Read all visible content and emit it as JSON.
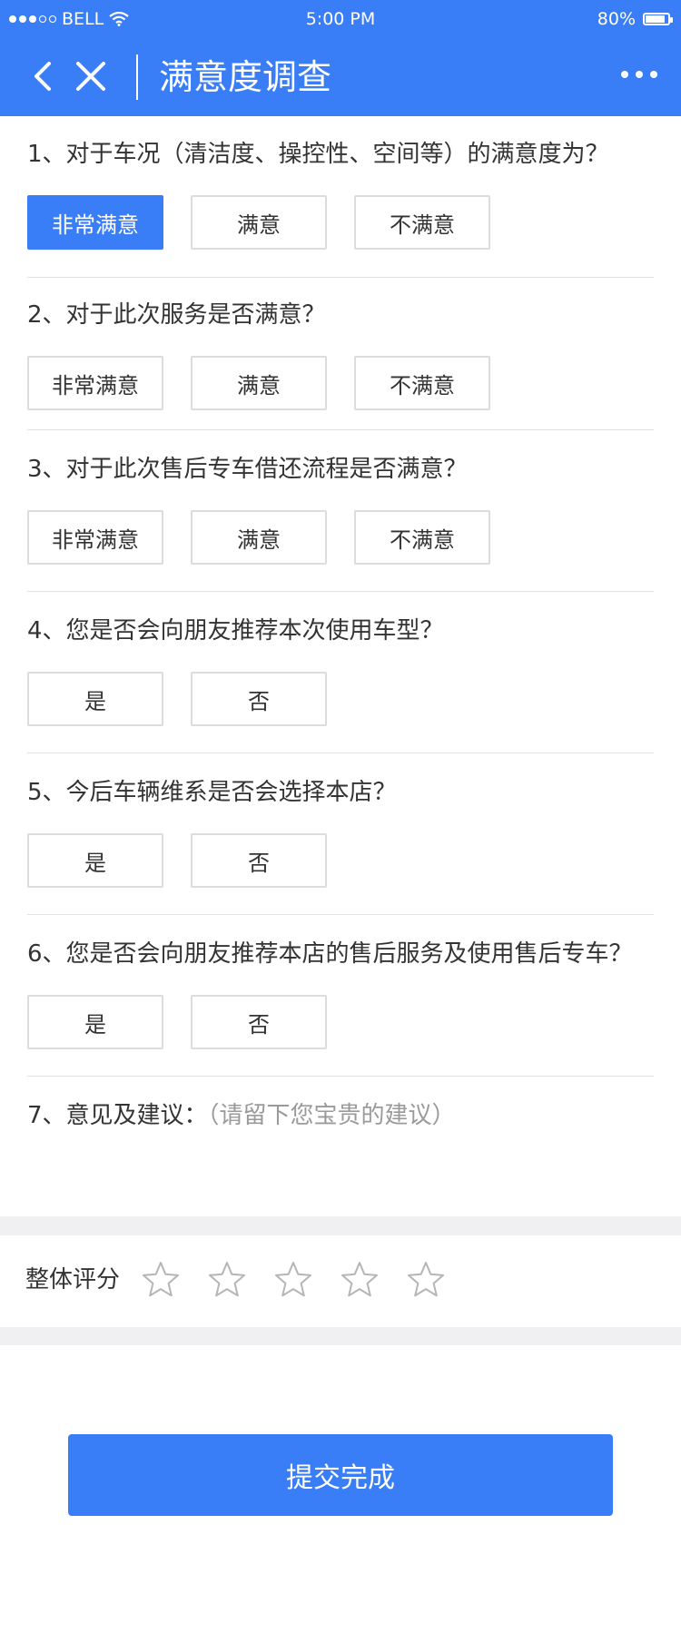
{
  "status_bar": {
    "carrier": "BELL",
    "time": "5:00 PM",
    "battery": "80%",
    "battery_level": 0.8
  },
  "nav": {
    "title": "满意度调查"
  },
  "questions": [
    {
      "text": "1、对于车况（清洁度、操控性、空间等）的满意度为？",
      "options": [
        "非常满意",
        "满意",
        "不满意"
      ],
      "selected": 0
    },
    {
      "text": "2、对于此次服务是否满意？",
      "options": [
        "非常满意",
        "满意",
        "不满意"
      ]
    },
    {
      "text": "3、对于此次售后专车借还流程是否满意？",
      "options": [
        "非常满意",
        "满意",
        "不满意"
      ]
    },
    {
      "text": "4、您是否会向朋友推荐本次使用车型？",
      "options": [
        "是",
        "否"
      ]
    },
    {
      "text": "5、今后车辆维系是否会选择本店？",
      "options": [
        "是",
        "否"
      ]
    },
    {
      "text": "6、您是否会向朋友推荐本店的售后服务及使用售后专车？",
      "options": [
        "是",
        "否"
      ]
    }
  ],
  "suggestion": {
    "label": "7、意见及建议：",
    "placeholder": "（请留下您宝贵的建议）"
  },
  "rating": {
    "label": "整体评分",
    "stars": 5,
    "value": 0
  },
  "submit": {
    "label": "提交完成"
  },
  "colors": {
    "accent": "#3a7ef7",
    "border": "#dcdcdc",
    "band": "#f0f0f2",
    "hint": "#9a9a9a"
  }
}
